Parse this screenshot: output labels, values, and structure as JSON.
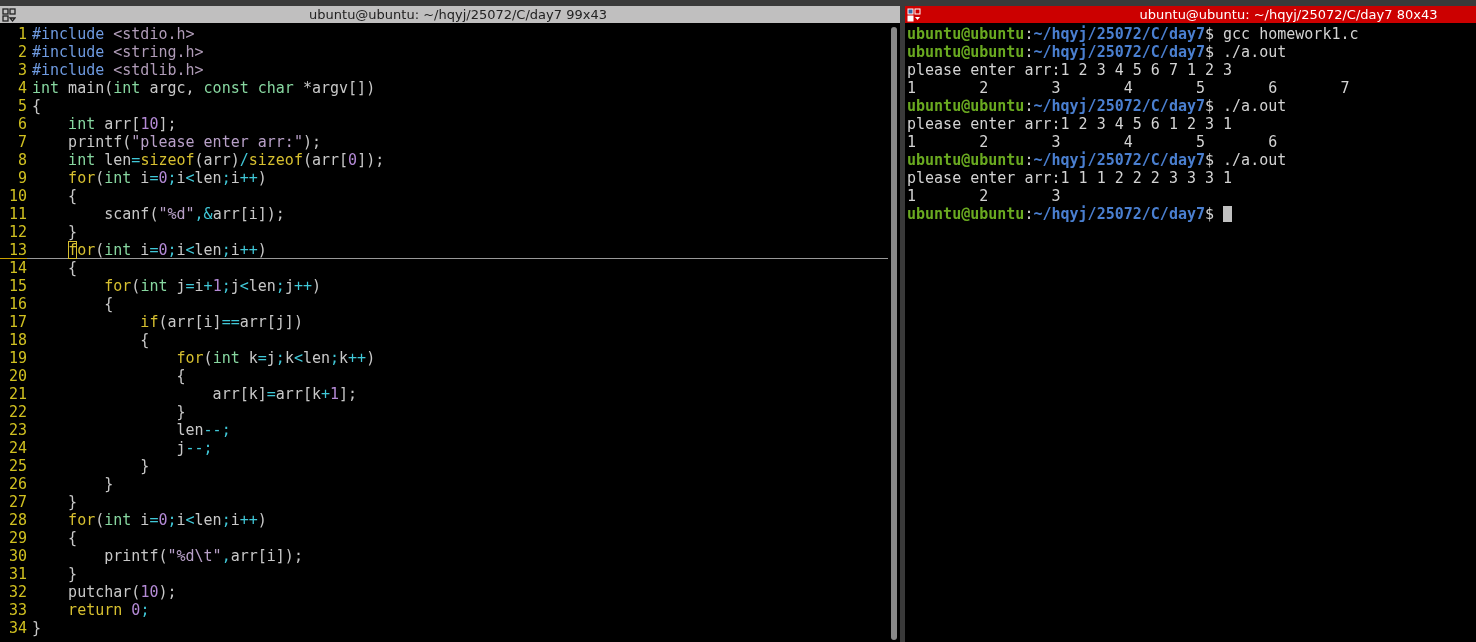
{
  "left_pane": {
    "title": "ubuntu@ubuntu: ~/hqyj/25072/C/day7 99x43",
    "active": false,
    "lines": [
      {
        "number": "1",
        "current": false,
        "segments": [
          {
            "kind": "pp",
            "text": "#include"
          },
          {
            "kind": "inc",
            "text": " <stdio.h>"
          }
        ]
      },
      {
        "number": "2",
        "current": false,
        "segments": [
          {
            "kind": "pp",
            "text": "#include"
          },
          {
            "kind": "inc",
            "text": " <string.h>"
          }
        ]
      },
      {
        "number": "3",
        "current": false,
        "segments": [
          {
            "kind": "pp",
            "text": "#include"
          },
          {
            "kind": "inc",
            "text": " <stdlib.h>"
          }
        ]
      },
      {
        "number": "4",
        "current": false,
        "segments": [
          {
            "kind": "type",
            "text": "int"
          },
          {
            "kind": "txt",
            "text": " main("
          },
          {
            "kind": "type",
            "text": "int"
          },
          {
            "kind": "txt",
            "text": " argc, "
          },
          {
            "kind": "type",
            "text": "const char"
          },
          {
            "kind": "txt",
            "text": " *argv[])"
          }
        ]
      },
      {
        "number": "5",
        "current": false,
        "segments": [
          {
            "kind": "txt",
            "text": "{"
          }
        ]
      },
      {
        "number": "6",
        "current": false,
        "segments": [
          {
            "kind": "type",
            "text": "    int"
          },
          {
            "kind": "txt",
            "text": " arr["
          },
          {
            "kind": "num",
            "text": "10"
          },
          {
            "kind": "txt",
            "text": "];"
          }
        ]
      },
      {
        "number": "7",
        "current": false,
        "segments": [
          {
            "kind": "txt",
            "text": "    printf("
          },
          {
            "kind": "str",
            "text": "\"please enter arr:\""
          },
          {
            "kind": "txt",
            "text": ");"
          }
        ]
      },
      {
        "number": "8",
        "current": false,
        "segments": [
          {
            "kind": "type",
            "text": "    int"
          },
          {
            "kind": "txt",
            "text": " len"
          },
          {
            "kind": "op",
            "text": "="
          },
          {
            "kind": "kw",
            "text": "sizeof"
          },
          {
            "kind": "txt",
            "text": "(arr)"
          },
          {
            "kind": "op",
            "text": "/"
          },
          {
            "kind": "kw",
            "text": "sizeof"
          },
          {
            "kind": "txt",
            "text": "(arr["
          },
          {
            "kind": "num",
            "text": "0"
          },
          {
            "kind": "txt",
            "text": "]);"
          }
        ]
      },
      {
        "number": "9",
        "current": false,
        "segments": [
          {
            "kind": "kw",
            "text": "    for"
          },
          {
            "kind": "txt",
            "text": "("
          },
          {
            "kind": "type",
            "text": "int"
          },
          {
            "kind": "txt",
            "text": " i"
          },
          {
            "kind": "op",
            "text": "="
          },
          {
            "kind": "num",
            "text": "0"
          },
          {
            "kind": "op",
            "text": ";"
          },
          {
            "kind": "txt",
            "text": "i"
          },
          {
            "kind": "op",
            "text": "<"
          },
          {
            "kind": "txt",
            "text": "len"
          },
          {
            "kind": "op",
            "text": ";"
          },
          {
            "kind": "txt",
            "text": "i"
          },
          {
            "kind": "op",
            "text": "++"
          },
          {
            "kind": "txt",
            "text": ")"
          }
        ]
      },
      {
        "number": "10",
        "current": false,
        "segments": [
          {
            "kind": "txt",
            "text": "    {"
          }
        ]
      },
      {
        "number": "11",
        "current": false,
        "segments": [
          {
            "kind": "txt",
            "text": "        scanf("
          },
          {
            "kind": "str",
            "text": "\"%d\""
          },
          {
            "kind": "op",
            "text": ",&"
          },
          {
            "kind": "txt",
            "text": "arr[i]);"
          }
        ]
      },
      {
        "number": "12",
        "current": false,
        "segments": [
          {
            "kind": "txt",
            "text": "    }"
          }
        ]
      },
      {
        "number": "13",
        "current": true,
        "segments": [
          {
            "kind": "cur",
            "text": "    f"
          },
          {
            "kind": "kw",
            "text": "or"
          },
          {
            "kind": "txt",
            "text": "("
          },
          {
            "kind": "type",
            "text": "int"
          },
          {
            "kind": "txt",
            "text": " i"
          },
          {
            "kind": "op",
            "text": "="
          },
          {
            "kind": "num",
            "text": "0"
          },
          {
            "kind": "op",
            "text": ";"
          },
          {
            "kind": "txt",
            "text": "i"
          },
          {
            "kind": "op",
            "text": "<"
          },
          {
            "kind": "txt",
            "text": "len"
          },
          {
            "kind": "op",
            "text": ";"
          },
          {
            "kind": "txt",
            "text": "i"
          },
          {
            "kind": "op",
            "text": "++"
          },
          {
            "kind": "txt",
            "text": ")"
          }
        ]
      },
      {
        "number": "14",
        "current": false,
        "segments": [
          {
            "kind": "txt",
            "text": "    {"
          }
        ]
      },
      {
        "number": "15",
        "current": false,
        "segments": [
          {
            "kind": "kw",
            "text": "        for"
          },
          {
            "kind": "txt",
            "text": "("
          },
          {
            "kind": "type",
            "text": "int"
          },
          {
            "kind": "txt",
            "text": " j"
          },
          {
            "kind": "op",
            "text": "="
          },
          {
            "kind": "txt",
            "text": "i"
          },
          {
            "kind": "op",
            "text": "+"
          },
          {
            "kind": "num",
            "text": "1"
          },
          {
            "kind": "op",
            "text": ";"
          },
          {
            "kind": "txt",
            "text": "j"
          },
          {
            "kind": "op",
            "text": "<"
          },
          {
            "kind": "txt",
            "text": "len"
          },
          {
            "kind": "op",
            "text": ";"
          },
          {
            "kind": "txt",
            "text": "j"
          },
          {
            "kind": "op",
            "text": "++"
          },
          {
            "kind": "txt",
            "text": ")"
          }
        ]
      },
      {
        "number": "16",
        "current": false,
        "segments": [
          {
            "kind": "txt",
            "text": "        {"
          }
        ]
      },
      {
        "number": "17",
        "current": false,
        "segments": [
          {
            "kind": "kw",
            "text": "            if"
          },
          {
            "kind": "txt",
            "text": "(arr[i]"
          },
          {
            "kind": "op",
            "text": "=="
          },
          {
            "kind": "txt",
            "text": "arr[j])"
          }
        ]
      },
      {
        "number": "18",
        "current": false,
        "segments": [
          {
            "kind": "txt",
            "text": "            {"
          }
        ]
      },
      {
        "number": "19",
        "current": false,
        "segments": [
          {
            "kind": "kw",
            "text": "                for"
          },
          {
            "kind": "txt",
            "text": "("
          },
          {
            "kind": "type",
            "text": "int"
          },
          {
            "kind": "txt",
            "text": " k"
          },
          {
            "kind": "op",
            "text": "="
          },
          {
            "kind": "txt",
            "text": "j"
          },
          {
            "kind": "op",
            "text": ";"
          },
          {
            "kind": "txt",
            "text": "k"
          },
          {
            "kind": "op",
            "text": "<"
          },
          {
            "kind": "txt",
            "text": "len"
          },
          {
            "kind": "op",
            "text": ";"
          },
          {
            "kind": "txt",
            "text": "k"
          },
          {
            "kind": "op",
            "text": "++"
          },
          {
            "kind": "txt",
            "text": ")"
          }
        ]
      },
      {
        "number": "20",
        "current": false,
        "segments": [
          {
            "kind": "txt",
            "text": "                {"
          }
        ]
      },
      {
        "number": "21",
        "current": false,
        "segments": [
          {
            "kind": "txt",
            "text": "                    arr[k]"
          },
          {
            "kind": "op",
            "text": "="
          },
          {
            "kind": "txt",
            "text": "arr[k"
          },
          {
            "kind": "op",
            "text": "+"
          },
          {
            "kind": "num",
            "text": "1"
          },
          {
            "kind": "txt",
            "text": "];"
          }
        ]
      },
      {
        "number": "22",
        "current": false,
        "segments": [
          {
            "kind": "txt",
            "text": "                }"
          }
        ]
      },
      {
        "number": "23",
        "current": false,
        "segments": [
          {
            "kind": "txt",
            "text": "                len"
          },
          {
            "kind": "op",
            "text": "--;"
          }
        ]
      },
      {
        "number": "24",
        "current": false,
        "segments": [
          {
            "kind": "txt",
            "text": "                j"
          },
          {
            "kind": "op",
            "text": "--;"
          }
        ]
      },
      {
        "number": "25",
        "current": false,
        "segments": [
          {
            "kind": "txt",
            "text": "            }"
          }
        ]
      },
      {
        "number": "26",
        "current": false,
        "segments": [
          {
            "kind": "txt",
            "text": "        }"
          }
        ]
      },
      {
        "number": "27",
        "current": false,
        "segments": [
          {
            "kind": "txt",
            "text": "    }"
          }
        ]
      },
      {
        "number": "28",
        "current": false,
        "segments": [
          {
            "kind": "kw",
            "text": "    for"
          },
          {
            "kind": "txt",
            "text": "("
          },
          {
            "kind": "type",
            "text": "int"
          },
          {
            "kind": "txt",
            "text": " i"
          },
          {
            "kind": "op",
            "text": "="
          },
          {
            "kind": "num",
            "text": "0"
          },
          {
            "kind": "op",
            "text": ";"
          },
          {
            "kind": "txt",
            "text": "i"
          },
          {
            "kind": "op",
            "text": "<"
          },
          {
            "kind": "txt",
            "text": "len"
          },
          {
            "kind": "op",
            "text": ";"
          },
          {
            "kind": "txt",
            "text": "i"
          },
          {
            "kind": "op",
            "text": "++"
          },
          {
            "kind": "txt",
            "text": ")"
          }
        ]
      },
      {
        "number": "29",
        "current": false,
        "segments": [
          {
            "kind": "txt",
            "text": "    {"
          }
        ]
      },
      {
        "number": "30",
        "current": false,
        "segments": [
          {
            "kind": "txt",
            "text": "        printf("
          },
          {
            "kind": "str",
            "text": "\"%d\\t\""
          },
          {
            "kind": "op",
            "text": ","
          },
          {
            "kind": "txt",
            "text": "arr[i]);"
          }
        ]
      },
      {
        "number": "31",
        "current": false,
        "segments": [
          {
            "kind": "txt",
            "text": "    }"
          }
        ]
      },
      {
        "number": "32",
        "current": false,
        "segments": [
          {
            "kind": "txt",
            "text": "    putchar("
          },
          {
            "kind": "num",
            "text": "10"
          },
          {
            "kind": "txt",
            "text": ");"
          }
        ]
      },
      {
        "number": "33",
        "current": false,
        "segments": [
          {
            "kind": "kw",
            "text": "    return"
          },
          {
            "kind": "num",
            "text": " 0"
          },
          {
            "kind": "op",
            "text": ";"
          }
        ]
      },
      {
        "number": "34",
        "current": false,
        "segments": [
          {
            "kind": "txt",
            "text": "}"
          }
        ]
      }
    ]
  },
  "right_pane": {
    "title": "ubuntu@ubuntu: ~/hqyj/25072/C/day7 80x43",
    "active": true,
    "lines": [
      {
        "kind": "prompt",
        "user": "ubuntu@ubuntu",
        "sep": ":",
        "path": "~/hqyj/25072/C/day7",
        "sigil": "$",
        "command": "gcc homework1.c",
        "cursor": false
      },
      {
        "kind": "prompt",
        "user": "ubuntu@ubuntu",
        "sep": ":",
        "path": "~/hqyj/25072/C/day7",
        "sigil": "$",
        "command": "./a.out",
        "cursor": false
      },
      {
        "kind": "output",
        "text": "please enter arr:1 2 3 4 5 6 7 1 2 3"
      },
      {
        "kind": "output",
        "text": "1\t2\t3\t4\t5\t6\t7"
      },
      {
        "kind": "prompt",
        "user": "ubuntu@ubuntu",
        "sep": ":",
        "path": "~/hqyj/25072/C/day7",
        "sigil": "$",
        "command": "./a.out",
        "cursor": false
      },
      {
        "kind": "output",
        "text": "please enter arr:1 2 3 4 5 6 1 2 3 1"
      },
      {
        "kind": "output",
        "text": "1\t2\t3\t4\t5\t6"
      },
      {
        "kind": "prompt",
        "user": "ubuntu@ubuntu",
        "sep": ":",
        "path": "~/hqyj/25072/C/day7",
        "sigil": "$",
        "command": "./a.out",
        "cursor": false
      },
      {
        "kind": "output",
        "text": "please enter arr:1 1 1 2 2 2 3 3 3 1"
      },
      {
        "kind": "output",
        "text": "1\t2\t3"
      },
      {
        "kind": "prompt",
        "user": "ubuntu@ubuntu",
        "sep": ":",
        "path": "~/hqyj/25072/C/day7",
        "sigil": "$",
        "cursor": true
      }
    ]
  }
}
